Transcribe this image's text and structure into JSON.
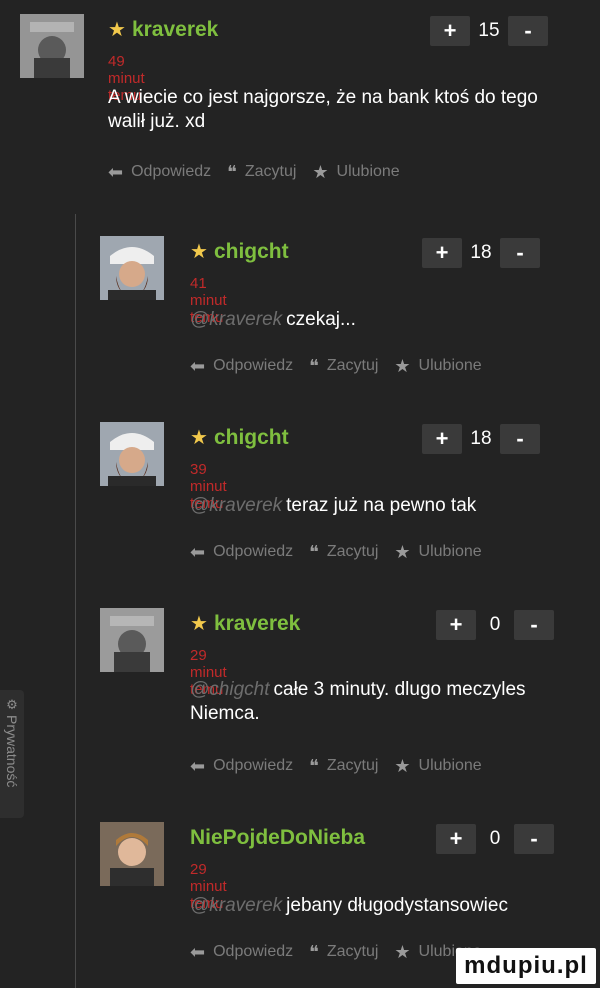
{
  "privacy": {
    "icon": "gear-icon",
    "label": "Prywatność"
  },
  "actions_labels": {
    "reply": "Odpowiedz",
    "quote": "Zacytuj",
    "favorite": "Ulubione"
  },
  "comments": [
    {
      "author": "kraverek",
      "time": "49 minut temu",
      "text": "A wiecie co jest najgorsze, że na bank ktoś do tego walił już. xd",
      "votes": "15",
      "star": true
    },
    {
      "author": "chigcht",
      "time": "41 minut temu",
      "mention": "@kraverek",
      "text": "czekaj...",
      "votes": "18",
      "star": true
    },
    {
      "author": "chigcht",
      "time": "39 minut temu",
      "mention": "@kraverek",
      "text": "teraz już na pewno tak",
      "votes": "18",
      "star": true
    },
    {
      "author": "kraverek",
      "time": "29 minut temu",
      "mention": "@chigcht",
      "text": "całe 3 minuty. dlugo meczyles Niemca.",
      "votes": "0",
      "star": true
    },
    {
      "author": "NiePojdeDoNieba",
      "time": "29 minut temu",
      "mention": "@kraverek",
      "text": "jebany długodystansowiec",
      "votes": "0",
      "star": false
    }
  ],
  "vote_labels": {
    "plus": "+",
    "minus": "-"
  },
  "watermark": "mdupiu.pl",
  "colors": {
    "background": "#232323",
    "author": "#7fbf3f",
    "time": "#c12a2a",
    "star": "#f2c94c",
    "mention": "#6d6d6d"
  }
}
